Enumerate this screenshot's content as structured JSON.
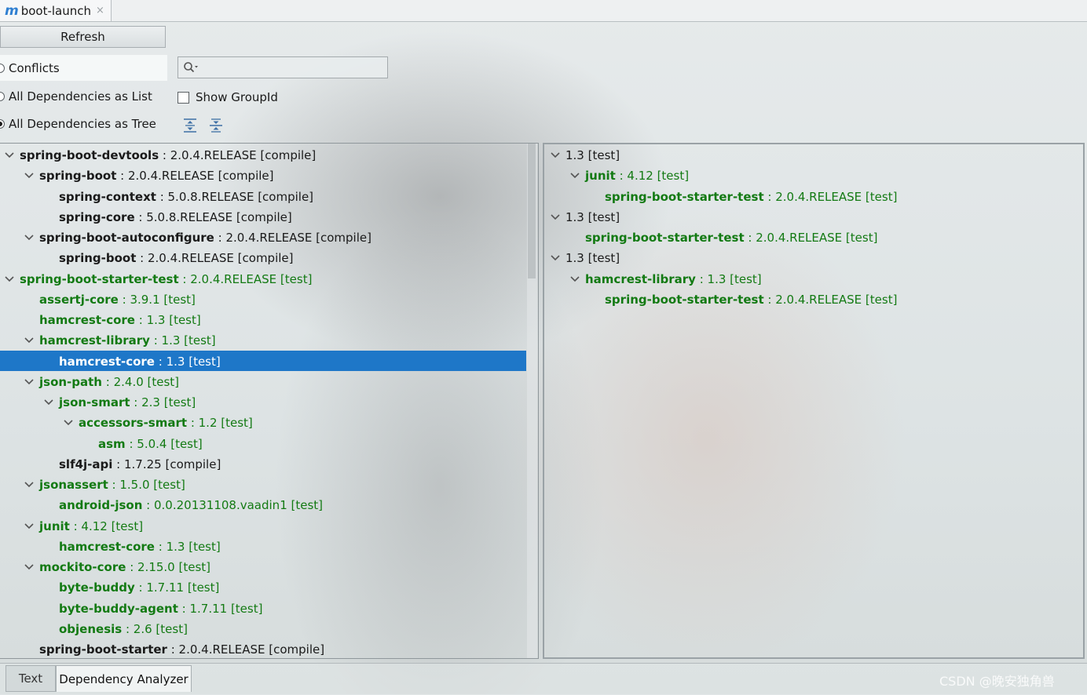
{
  "editor_tab": {
    "icon": "m",
    "title": "boot-launch",
    "close": "×"
  },
  "toolbar": {
    "refresh_label": "Refresh",
    "search_value": "",
    "search_placeholder": "",
    "options": [
      {
        "label": "Conflicts",
        "selected": false
      },
      {
        "label": "All Dependencies as List",
        "selected": false
      },
      {
        "label": "All Dependencies as Tree",
        "selected": true
      }
    ],
    "show_groupid_label": "Show GroupId",
    "show_groupid_checked": false
  },
  "left_tree": [
    {
      "name": "spring-boot-devtools",
      "rest": " : 2.0.4.RELEASE [compile]",
      "level": 0,
      "expanded": true,
      "green": false
    },
    {
      "name": "spring-boot",
      "rest": " : 2.0.4.RELEASE [compile]",
      "level": 1,
      "expanded": true,
      "green": false
    },
    {
      "name": "spring-context",
      "rest": " : 5.0.8.RELEASE [compile]",
      "level": 2,
      "expanded": null,
      "green": false
    },
    {
      "name": "spring-core",
      "rest": " : 5.0.8.RELEASE [compile]",
      "level": 2,
      "expanded": null,
      "green": false
    },
    {
      "name": "spring-boot-autoconfigure",
      "rest": " : 2.0.4.RELEASE [compile]",
      "level": 1,
      "expanded": true,
      "green": false
    },
    {
      "name": "spring-boot",
      "rest": " : 2.0.4.RELEASE [compile]",
      "level": 2,
      "expanded": null,
      "green": false
    },
    {
      "name": "spring-boot-starter-test",
      "rest": " : 2.0.4.RELEASE [test]",
      "level": 0,
      "expanded": true,
      "green": true
    },
    {
      "name": "assertj-core",
      "rest": " : 3.9.1 [test]",
      "level": 1,
      "expanded": null,
      "green": true
    },
    {
      "name": "hamcrest-core",
      "rest": " : 1.3 [test]",
      "level": 1,
      "expanded": null,
      "green": true
    },
    {
      "name": "hamcrest-library",
      "rest": " : 1.3 [test]",
      "level": 1,
      "expanded": true,
      "green": true
    },
    {
      "name": "hamcrest-core",
      "rest": " : 1.3 [test]",
      "level": 2,
      "expanded": null,
      "green": true,
      "selected": true
    },
    {
      "name": "json-path",
      "rest": " : 2.4.0 [test]",
      "level": 1,
      "expanded": true,
      "green": true
    },
    {
      "name": "json-smart",
      "rest": " : 2.3 [test]",
      "level": 2,
      "expanded": true,
      "green": true
    },
    {
      "name": "accessors-smart",
      "rest": " : 1.2 [test]",
      "level": 3,
      "expanded": true,
      "green": true
    },
    {
      "name": "asm",
      "rest": " : 5.0.4 [test]",
      "level": 4,
      "expanded": null,
      "green": true
    },
    {
      "name": "slf4j-api",
      "rest": " : 1.7.25 [compile]",
      "level": 2,
      "expanded": null,
      "green": false
    },
    {
      "name": "jsonassert",
      "rest": " : 1.5.0 [test]",
      "level": 1,
      "expanded": true,
      "green": true
    },
    {
      "name": "android-json",
      "rest": " : 0.0.20131108.vaadin1 [test]",
      "level": 2,
      "expanded": null,
      "green": true
    },
    {
      "name": "junit",
      "rest": " : 4.12 [test]",
      "level": 1,
      "expanded": true,
      "green": true
    },
    {
      "name": "hamcrest-core",
      "rest": " : 1.3 [test]",
      "level": 2,
      "expanded": null,
      "green": true
    },
    {
      "name": "mockito-core",
      "rest": " : 2.15.0 [test]",
      "level": 1,
      "expanded": true,
      "green": true
    },
    {
      "name": "byte-buddy",
      "rest": " : 1.7.11 [test]",
      "level": 2,
      "expanded": null,
      "green": true
    },
    {
      "name": "byte-buddy-agent",
      "rest": " : 1.7.11 [test]",
      "level": 2,
      "expanded": null,
      "green": true
    },
    {
      "name": "objenesis",
      "rest": " : 2.6 [test]",
      "level": 2,
      "expanded": null,
      "green": true
    },
    {
      "name": "spring-boot-starter",
      "rest": " : 2.0.4.RELEASE [compile]",
      "level": 1,
      "expanded": null,
      "green": false
    }
  ],
  "right_tree": [
    {
      "name": "",
      "rest": "1.3 [test]",
      "level": 0,
      "expanded": true,
      "green": false
    },
    {
      "name": "junit",
      "rest": " : 4.12 [test]",
      "level": 1,
      "expanded": true,
      "green": true
    },
    {
      "name": "spring-boot-starter-test",
      "rest": " : 2.0.4.RELEASE [test]",
      "level": 2,
      "expanded": null,
      "green": true
    },
    {
      "name": "",
      "rest": "1.3 [test]",
      "level": 0,
      "expanded": true,
      "green": false
    },
    {
      "name": "spring-boot-starter-test",
      "rest": " : 2.0.4.RELEASE [test]",
      "level": 1,
      "expanded": null,
      "green": true
    },
    {
      "name": "",
      "rest": "1.3 [test]",
      "level": 0,
      "expanded": true,
      "green": false
    },
    {
      "name": "hamcrest-library",
      "rest": " : 1.3 [test]",
      "level": 1,
      "expanded": true,
      "green": true
    },
    {
      "name": "spring-boot-starter-test",
      "rest": " : 2.0.4.RELEASE [test]",
      "level": 2,
      "expanded": null,
      "green": true
    }
  ],
  "bottom_tabs": [
    {
      "label": "Text",
      "active": false
    },
    {
      "label": "Dependency Analyzer",
      "active": true
    }
  ],
  "watermark": "CSDN @晚安独角兽",
  "colors": {
    "selection": "#1e77c8",
    "test_scope": "#137a13",
    "compile_scope": "#1a1a1a"
  },
  "icons": {
    "expand_all": "expand-all-icon",
    "collapse_all": "collapse-all-icon",
    "search": "search-icon"
  }
}
